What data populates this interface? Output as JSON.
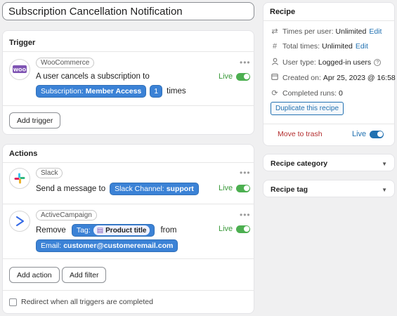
{
  "recipe_title": "Subscription Cancellation Notification",
  "trigger": {
    "heading": "Trigger",
    "integration": "WooCommerce",
    "sentence_prefix": "A user cancels a subscription to",
    "token_label": "Subscription:",
    "token_value": "Member Access",
    "count_value": "1",
    "sentence_suffix": "times",
    "status": "Live",
    "add_button": "Add trigger"
  },
  "actions": {
    "heading": "Actions",
    "items": [
      {
        "integration": "Slack",
        "sentence_prefix": "Send a message to",
        "token_label": "Slack Channel:",
        "token_value": "support",
        "status": "Live"
      },
      {
        "integration": "ActiveCampaign",
        "sentence_prefix": "Remove",
        "token_label": "Tag:",
        "token_pill": "Product title",
        "sentence_mid": "from",
        "token2_label": "Email:",
        "token2_value": "customer@customeremail.com",
        "status": "Live"
      }
    ],
    "add_action_button": "Add action",
    "add_filter_button": "Add filter",
    "redirect_label": "Redirect when all triggers are completed"
  },
  "recipe": {
    "heading": "Recipe",
    "times_per_user_label": "Times per user:",
    "times_per_user_value": "Unlimited",
    "total_times_label": "Total times:",
    "total_times_value": "Unlimited",
    "edit_link": "Edit",
    "user_type_label": "User type:",
    "user_type_value": "Logged-in users",
    "created_label": "Created on:",
    "created_value": "Apr 25, 2023 @ 16:58",
    "completed_label": "Completed runs:",
    "completed_value": "0",
    "duplicate_button": "Duplicate this recipe",
    "trash_link": "Move to trash",
    "status": "Live"
  },
  "recipe_category": {
    "heading": "Recipe category"
  },
  "recipe_tag": {
    "heading": "Recipe tag"
  },
  "colors": {
    "accent": "#2271b1",
    "token": "#3b82d6",
    "live": "#4caf50",
    "trash": "#b32d2e"
  }
}
